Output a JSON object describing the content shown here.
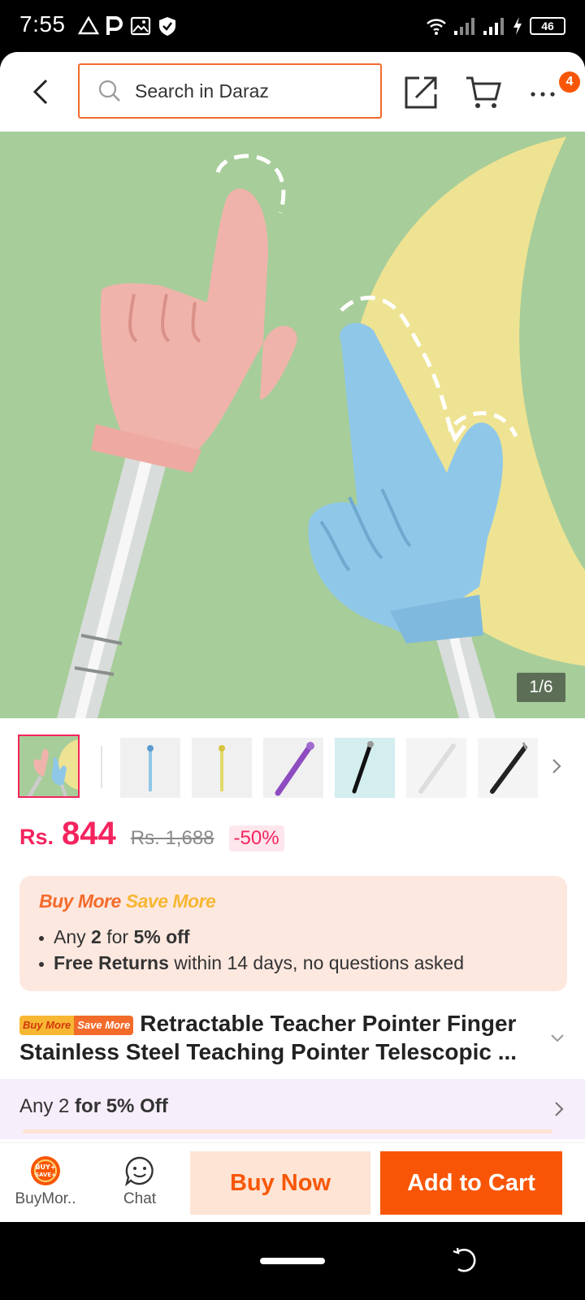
{
  "status_bar": {
    "time": "7:55",
    "battery": "46"
  },
  "header": {
    "search_placeholder": "Search in Daraz",
    "cart_count": "4"
  },
  "gallery": {
    "page_indicator": "1/6",
    "thumbnail_count": 7
  },
  "price": {
    "currency": "Rs.",
    "current": "844",
    "original": "Rs. 1,688",
    "discount": "-50%"
  },
  "promo": {
    "title_part1": "Buy More",
    "title_part2": "Save More",
    "line1_pre": "Any ",
    "line1_bold1": "2",
    "line1_mid": " for ",
    "line1_bold2": "5% off",
    "line2_bold": "Free Returns",
    "line2_rest": " within 14 days, no questions asked"
  },
  "product": {
    "tag_part1": "Buy More",
    "tag_part2": "Save More",
    "title": "Retractable Teacher Pointer Finger Stainless Steel Teaching Pointer Telescopic ..."
  },
  "offer": {
    "pre": "Any 2 ",
    "bold": "for 5% Off"
  },
  "bottom_bar": {
    "buymore_label": "BuyMor..",
    "buymore_icon_text1": "BUY+",
    "buymore_icon_text2": "SAVE+",
    "chat_label": "Chat",
    "buy_now": "Buy Now",
    "add_to_cart": "Add to Cart"
  },
  "colors": {
    "brand_orange": "#f85606",
    "price_pink": "#f5245e",
    "promo_bg": "#fde8e0"
  }
}
